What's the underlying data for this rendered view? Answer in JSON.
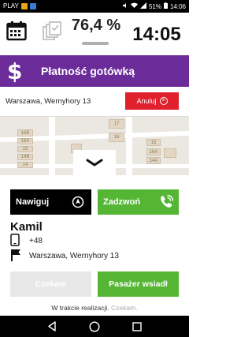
{
  "statusbar": {
    "carrier": "PLAY",
    "battery": "51%",
    "time": "14:06"
  },
  "topbar": {
    "percent": "76,4 %",
    "clock": "14:05",
    "icons": [
      "calendar-icon",
      "documents-icon"
    ]
  },
  "payment": {
    "symbol": "$",
    "label": "Płatność gotówką",
    "color": "#6b2c9a"
  },
  "trip": {
    "address": "Warszawa, Wernyhory 13",
    "cancel_label": "Anuluj"
  },
  "map": {
    "building_numbers": [
      "16B",
      "16A",
      "15",
      "14",
      "14B",
      "17",
      "16",
      "14A",
      "16A",
      "15"
    ]
  },
  "actions": {
    "navigate_label": "Nawiguj",
    "call_label": "Zadzwoń",
    "call_color": "#55b535"
  },
  "customer": {
    "name": "Kamil",
    "phone": "+48",
    "address": "Warszawa, Wernyhory 13"
  },
  "bottom": {
    "wait_label": "Czekam",
    "boarded_label": "Pasażer wsiadł"
  },
  "status": {
    "text": "W trakcie realizacji.",
    "muted": "Czekam."
  }
}
